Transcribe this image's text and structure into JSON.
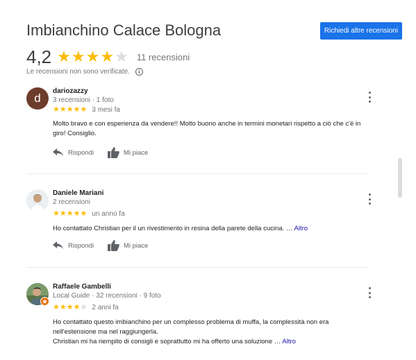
{
  "header": {
    "title": "Imbianchino Calace Bologna",
    "request_button": "Richiedi altre recensioni"
  },
  "summary": {
    "score": "4,2",
    "stars": 4,
    "count_text": "11 recensioni",
    "unverified_text": "Le recensioni non sono verificate.",
    "info_icon": "i"
  },
  "reviews": [
    {
      "author": "dariozazzy",
      "avatar_letter": "d",
      "meta": "3 recensioni · 1 foto",
      "stars": 5,
      "time_ago": "3 mesi fa",
      "text": "Molto bravo e con esperienza da vendere!! Molto buono anche in termini monetari rispetto a ciò che c'è in giro! Consiglio.",
      "more": "",
      "reply_label": "Rispondi",
      "like_label": "Mi piace"
    },
    {
      "author": "Daniele Mariani",
      "avatar_letter": "",
      "meta": "2 recensioni",
      "stars": 5,
      "time_ago": "un anno fa",
      "text": "Ho contattato Christian per il un rivestimento in resina della parete della cucina. …",
      "more": "Altro",
      "reply_label": "Rispondi",
      "like_label": "Mi piace"
    },
    {
      "author": "Raffaele Gambelli",
      "avatar_letter": "",
      "meta": "Local Guide · 32 recensioni · 9 foto",
      "stars": 4,
      "time_ago": "2 anni fa",
      "text": "Ho contattato questo imbianchino per un complesso problema di muffa, la complessità non era nell'estensione ma nel raggiungerla.\nChristian mi ha riempito di consigli e soprattutto mi ha offerto una soluzione …",
      "more": "Altro",
      "reply_label": "",
      "like_label": ""
    }
  ],
  "colors": {
    "accent": "#1a73e8",
    "star": "#fbbc04",
    "star_empty": "#dadce0",
    "link": "#1a0dab"
  },
  "icons": [
    "info-icon",
    "star-icon",
    "reply-arrow-icon",
    "thumbs-up-icon",
    "more-vert-icon",
    "local-guide-badge-icon"
  ]
}
